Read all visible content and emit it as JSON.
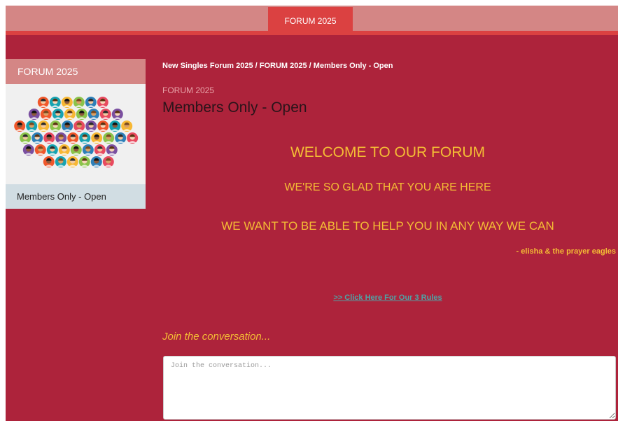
{
  "nav": {
    "active_tab": "FORUM 2025"
  },
  "sidebar": {
    "header": "FORUM 2025",
    "image_icon": "community-people-icon",
    "footer": "Members Only - Open"
  },
  "breadcrumb": "New Singles Forum 2025 / FORUM 2025 / Members Only - Open",
  "page": {
    "kicker": "FORUM 2025",
    "title": "Members Only - Open"
  },
  "welcome": {
    "line1": "WELCOME TO OUR FORUM",
    "line2": "WE'RE SO GLAD THAT YOU ARE HERE",
    "line3": "WE WANT TO BE ABLE TO HELP YOU IN ANY WAY WE CAN",
    "signature": "- elisha & the prayer eagles"
  },
  "rules_link": ">> Click Here For Our 3 Rules",
  "conversation": {
    "label": "Join the conversation...",
    "placeholder": "Join the conversation..."
  },
  "colors": {
    "background": "#ad233b",
    "accent": "#db4141",
    "header_band": "#d48685",
    "highlight_text": "#f4bd35",
    "link": "#4fa3a5"
  }
}
